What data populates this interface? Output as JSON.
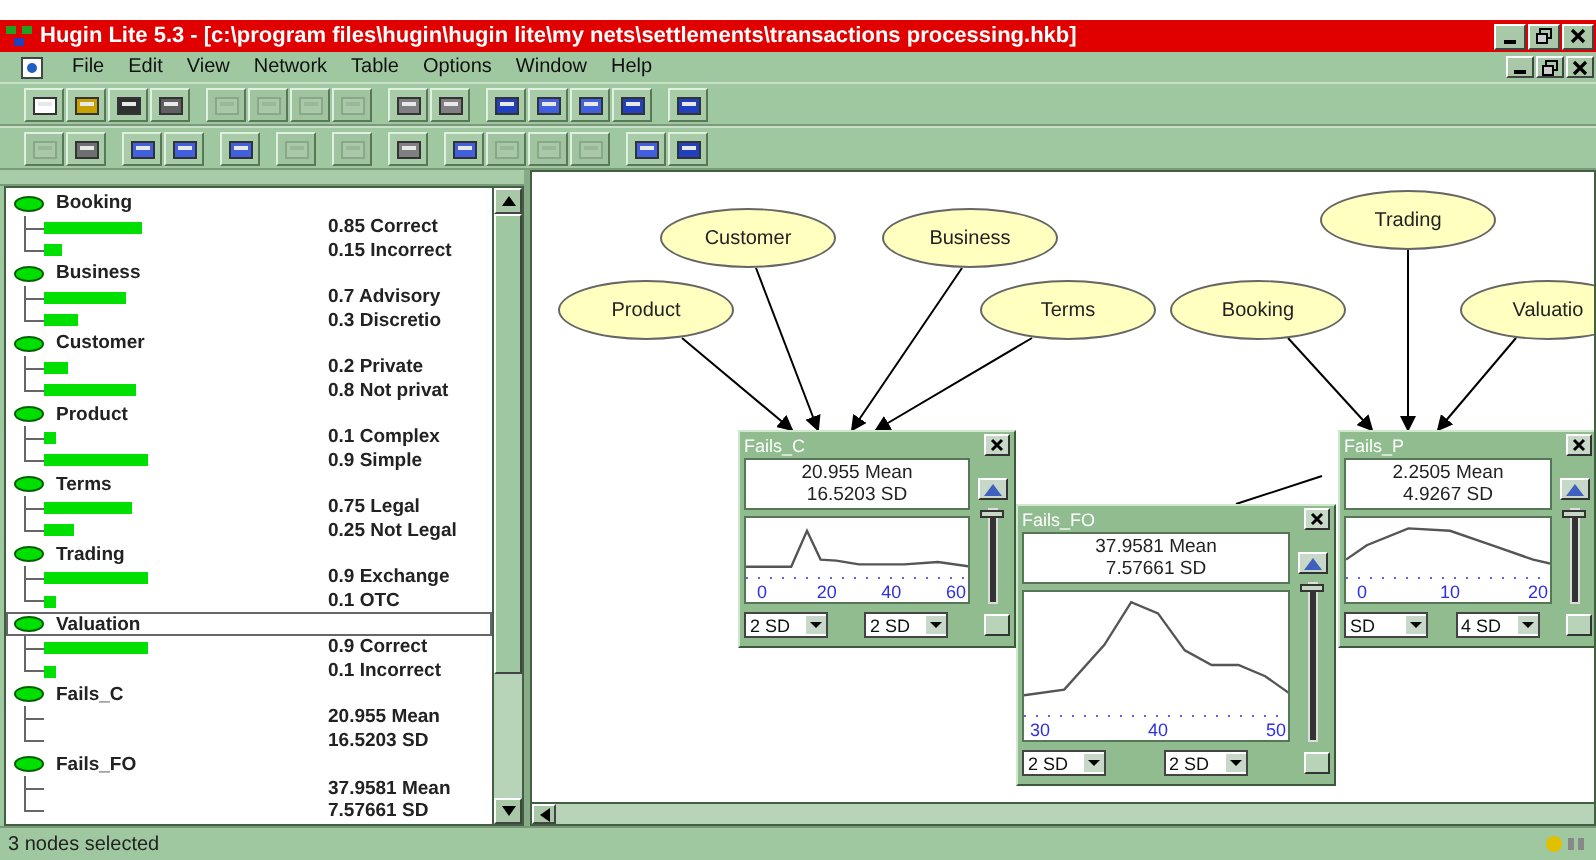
{
  "window": {
    "title": "Hugin Lite 5.3 - [c:\\program files\\hugin\\hugin lite\\my nets\\settlements\\transactions processing.hkb]"
  },
  "menu": [
    "File",
    "Edit",
    "View",
    "Network",
    "Table",
    "Options",
    "Window",
    "Help"
  ],
  "toolbars": [
    {
      "groups": [
        {
          "buttons": [
            {
              "disabled": false
            },
            {
              "disabled": false
            },
            {
              "disabled": false
            },
            {
              "disabled": false
            }
          ]
        },
        {
          "buttons": [
            {
              "disabled": true
            },
            {
              "disabled": true
            },
            {
              "disabled": true
            },
            {
              "disabled": true
            }
          ]
        },
        {
          "buttons": [
            {
              "disabled": false
            },
            {
              "disabled": false
            }
          ]
        },
        {
          "buttons": [
            {
              "disabled": false
            },
            {
              "disabled": false
            },
            {
              "disabled": false
            },
            {
              "disabled": false
            }
          ]
        },
        {
          "buttons": [
            {
              "disabled": false
            }
          ]
        }
      ]
    },
    {
      "groups": [
        {
          "buttons": [
            {
              "disabled": true
            },
            {
              "disabled": false
            }
          ]
        },
        {
          "buttons": [
            {
              "disabled": false
            },
            {
              "disabled": false
            }
          ]
        },
        {
          "buttons": [
            {
              "disabled": false
            }
          ]
        },
        {
          "buttons": [
            {
              "disabled": true
            }
          ]
        },
        {
          "buttons": [
            {
              "disabled": true
            }
          ]
        },
        {
          "buttons": [
            {
              "disabled": false
            }
          ]
        },
        {
          "buttons": [
            {
              "disabled": false
            },
            {
              "disabled": true
            },
            {
              "disabled": true
            },
            {
              "disabled": true
            }
          ]
        },
        {
          "buttons": [
            {
              "disabled": false
            },
            {
              "disabled": false
            }
          ]
        }
      ]
    }
  ],
  "tree": [
    {
      "name": "Booking",
      "kind": "discrete",
      "selected": false,
      "states": [
        {
          "text": "0.85 Correct"
        },
        {
          "text": "0.15 Incorrect"
        }
      ]
    },
    {
      "name": "Business",
      "kind": "discrete",
      "selected": false,
      "states": [
        {
          "text": "0.7 Advisory"
        },
        {
          "text": "0.3 Discretio"
        }
      ]
    },
    {
      "name": "Customer",
      "kind": "discrete",
      "selected": false,
      "states": [
        {
          "text": "0.2 Private"
        },
        {
          "text": "0.8 Not privat"
        }
      ]
    },
    {
      "name": "Product",
      "kind": "discrete",
      "selected": false,
      "states": [
        {
          "text": "0.1 Complex"
        },
        {
          "text": "0.9 Simple"
        }
      ]
    },
    {
      "name": "Terms",
      "kind": "discrete",
      "selected": false,
      "states": [
        {
          "text": "0.75 Legal"
        },
        {
          "text": "0.25 Not Legal"
        }
      ]
    },
    {
      "name": "Trading",
      "kind": "discrete",
      "selected": false,
      "states": [
        {
          "text": "0.9 Exchange"
        },
        {
          "text": "0.1 OTC"
        }
      ]
    },
    {
      "name": "Valuation",
      "kind": "discrete",
      "selected": true,
      "states": [
        {
          "text": "0.9 Correct"
        },
        {
          "text": "0.1 Incorrect"
        }
      ]
    },
    {
      "name": "Fails_C",
      "kind": "continuous",
      "selected": false,
      "states": [
        {
          "text": "20.955 Mean"
        },
        {
          "text": "16.5203 SD"
        }
      ]
    },
    {
      "name": "Fails_FO",
      "kind": "continuous",
      "selected": false,
      "states": [
        {
          "text": "37.9581 Mean"
        },
        {
          "text": "7.57661 SD"
        }
      ]
    }
  ],
  "graph_nodes": [
    "Customer",
    "Business",
    "Product",
    "Terms",
    "Booking",
    "Trading",
    "Valuatio"
  ],
  "monitors": [
    {
      "title": "Fails_C",
      "level": 1,
      "mean": "20.955 Mean",
      "sd": "16.5203 SD",
      "ticks": [
        "0",
        "20",
        "40",
        "60"
      ],
      "dropdowns": [
        "2 SD",
        "2 SD"
      ]
    },
    {
      "title": "Fails_P",
      "level": 1,
      "mean": "2.2505 Mean",
      "sd": "4.9267 SD",
      "ticks": [
        "0",
        "10",
        "20"
      ],
      "dropdowns": [
        "SD",
        "4 SD"
      ]
    },
    {
      "title": "Fails_FO",
      "level": 1,
      "mean": "37.9581 Mean",
      "sd": "7.57661 SD",
      "ticks": [
        "30",
        "40",
        "50"
      ],
      "dropdowns": [
        "2 SD",
        "2 SD"
      ]
    }
  ],
  "status_bar": {
    "text": "3 nodes selected"
  }
}
